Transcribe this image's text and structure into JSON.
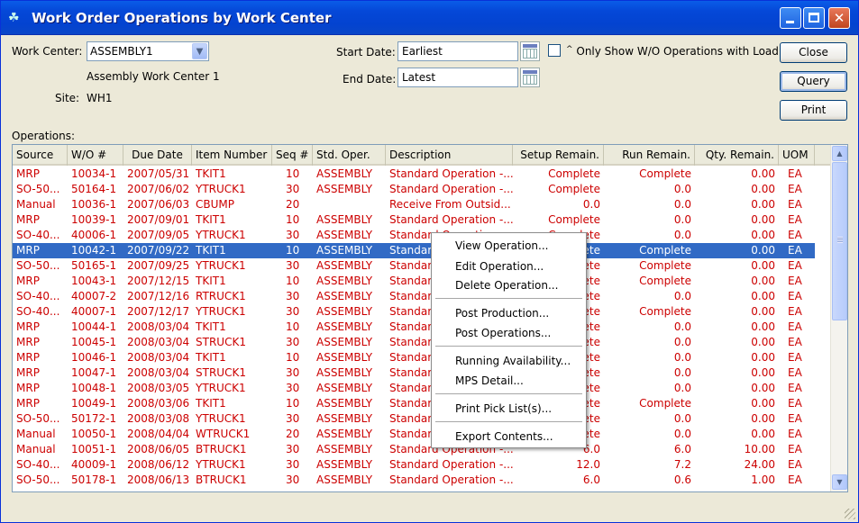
{
  "window": {
    "title": "Work Order Operations by Work Center"
  },
  "form": {
    "work_center_label": "Work Center:",
    "work_center_value": "ASSEMBLY1",
    "work_center_desc": "Assembly Work Center 1",
    "site_label": "Site:",
    "site_value": "WH1",
    "start_date_label": "Start Date:",
    "start_date_value": "Earliest",
    "end_date_label": "End Date:",
    "end_date_value": "Latest",
    "only_show_label": "Only Show W/O Operations with Load",
    "operations_label": "Operations:"
  },
  "buttons": {
    "close": "Close",
    "query": "Query",
    "print": "Print"
  },
  "table": {
    "columns": [
      "Source",
      "W/O #",
      "Due Date",
      "Item Number",
      "Seq #",
      "Std. Oper.",
      "Description",
      "Setup Remain.",
      "Run Remain.",
      "Qty. Remain.",
      "UOM"
    ],
    "rows": [
      [
        "MRP",
        "10034-1",
        "2007/05/31",
        "TKIT1",
        "10",
        "ASSEMBLY",
        "Standard Operation -...",
        "Complete",
        "Complete",
        "0.00",
        "EA"
      ],
      [
        "SO-50...",
        "50164-1",
        "2007/06/02",
        "YTRUCK1",
        "30",
        "ASSEMBLY",
        "Standard Operation -...",
        "Complete",
        "0.0",
        "0.00",
        "EA"
      ],
      [
        "Manual",
        "10036-1",
        "2007/06/03",
        "CBUMP",
        "20",
        "",
        "Receive From Outsid...",
        "0.0",
        "0.0",
        "0.00",
        "EA"
      ],
      [
        "MRP",
        "10039-1",
        "2007/09/01",
        "TKIT1",
        "10",
        "ASSEMBLY",
        "Standard Operation -...",
        "Complete",
        "0.0",
        "0.00",
        "EA"
      ],
      [
        "SO-40...",
        "40006-1",
        "2007/09/05",
        "YTRUCK1",
        "30",
        "ASSEMBLY",
        "Standard Operation -...",
        "Complete",
        "0.0",
        "0.00",
        "EA"
      ],
      [
        "MRP",
        "10042-1",
        "2007/09/22",
        "TKIT1",
        "10",
        "ASSEMBLY",
        "Standard Operation -...",
        "Complete",
        "Complete",
        "0.00",
        "EA"
      ],
      [
        "SO-50...",
        "50165-1",
        "2007/09/25",
        "YTRUCK1",
        "30",
        "ASSEMBLY",
        "Standard Operation -...",
        "Complete",
        "Complete",
        "0.00",
        "EA"
      ],
      [
        "MRP",
        "10043-1",
        "2007/12/15",
        "TKIT1",
        "10",
        "ASSEMBLY",
        "Standard Operation -...",
        "Complete",
        "Complete",
        "0.00",
        "EA"
      ],
      [
        "SO-40...",
        "40007-2",
        "2007/12/16",
        "RTRUCK1",
        "30",
        "ASSEMBLY",
        "Standard Operation -...",
        "Complete",
        "0.0",
        "0.00",
        "EA"
      ],
      [
        "SO-40...",
        "40007-1",
        "2007/12/17",
        "YTRUCK1",
        "30",
        "ASSEMBLY",
        "Standard Operation -...",
        "Complete",
        "Complete",
        "0.00",
        "EA"
      ],
      [
        "MRP",
        "10044-1",
        "2008/03/04",
        "TKIT1",
        "10",
        "ASSEMBLY",
        "Standard Operation -...",
        "Complete",
        "0.0",
        "0.00",
        "EA"
      ],
      [
        "MRP",
        "10045-1",
        "2008/03/04",
        "STRUCK1",
        "30",
        "ASSEMBLY",
        "Standard Operation -...",
        "Complete",
        "0.0",
        "0.00",
        "EA"
      ],
      [
        "MRP",
        "10046-1",
        "2008/03/04",
        "TKIT1",
        "10",
        "ASSEMBLY",
        "Standard Operation -...",
        "Complete",
        "0.0",
        "0.00",
        "EA"
      ],
      [
        "MRP",
        "10047-1",
        "2008/03/04",
        "STRUCK1",
        "30",
        "ASSEMBLY",
        "Standard Operation -...",
        "Complete",
        "0.0",
        "0.00",
        "EA"
      ],
      [
        "MRP",
        "10048-1",
        "2008/03/05",
        "YTRUCK1",
        "30",
        "ASSEMBLY",
        "Standard Operation -...",
        "Complete",
        "0.0",
        "0.00",
        "EA"
      ],
      [
        "MRP",
        "10049-1",
        "2008/03/06",
        "TKIT1",
        "10",
        "ASSEMBLY",
        "Standard Operation -...",
        "Complete",
        "Complete",
        "0.00",
        "EA"
      ],
      [
        "SO-50...",
        "50172-1",
        "2008/03/08",
        "YTRUCK1",
        "30",
        "ASSEMBLY",
        "Standard Operation -...",
        "Complete",
        "0.0",
        "0.00",
        "EA"
      ],
      [
        "Manual",
        "10050-1",
        "2008/04/04",
        "WTRUCK1",
        "20",
        "ASSEMBLY",
        "Standard Operation -...",
        "Complete",
        "0.0",
        "0.00",
        "EA"
      ],
      [
        "Manual",
        "10051-1",
        "2008/06/05",
        "BTRUCK1",
        "30",
        "ASSEMBLY",
        "Standard Operation -...",
        "6.0",
        "6.0",
        "10.00",
        "EA"
      ],
      [
        "SO-40...",
        "40009-1",
        "2008/06/12",
        "YTRUCK1",
        "30",
        "ASSEMBLY",
        "Standard Operation -...",
        "12.0",
        "7.2",
        "24.00",
        "EA"
      ],
      [
        "SO-50...",
        "50178-1",
        "2008/06/13",
        "BTRUCK1",
        "30",
        "ASSEMBLY",
        "Standard Operation -...",
        "6.0",
        "0.6",
        "1.00",
        "EA"
      ]
    ],
    "selected_row": 5
  },
  "context_menu": {
    "items": [
      "View Operation...",
      "Edit Operation...",
      "Delete Operation...",
      "Post Production...",
      "Post Operations...",
      "Running Availability...",
      "MPS Detail...",
      "Print Pick List(s)...",
      "Export Contents..."
    ]
  },
  "colors": {
    "row_text": "#cc0000",
    "selection": "#316ac5",
    "titlebar": "#0548d8"
  }
}
